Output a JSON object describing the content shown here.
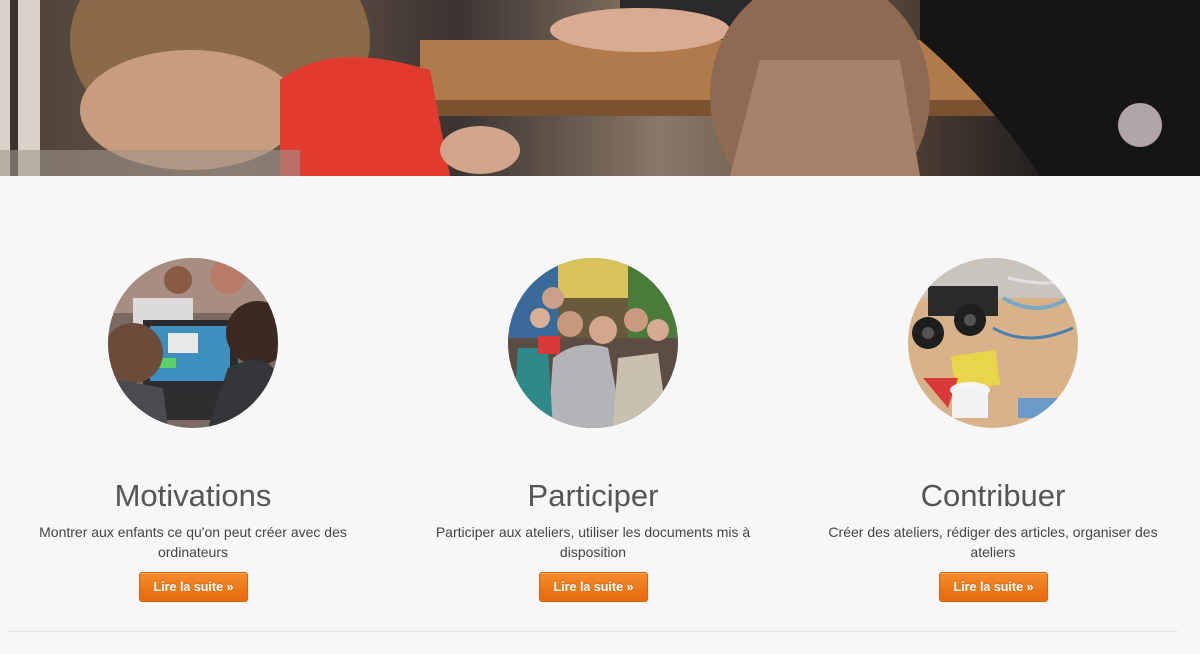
{
  "features": [
    {
      "title": "Motivations",
      "description": "Montrer aux enfants ce qu'on peut créer avec des ordinateurs",
      "button_label": "Lire la suite »",
      "photo_icon": "kids-at-computer-photo"
    },
    {
      "title": "Participer",
      "description": "Participer aux ateliers, utiliser les documents mis à disposition",
      "button_label": "Lire la suite »",
      "photo_icon": "group-of-children-photo"
    },
    {
      "title": "Contribuer",
      "description": "Créer des ateliers, rédiger des articles, organiser des ateliers",
      "button_label": "Lire la suite »",
      "photo_icon": "robot-car-workshop-photo"
    }
  ],
  "colors": {
    "accent": "#ee7a1e",
    "background": "#f7f7f7",
    "text": "#555555"
  }
}
